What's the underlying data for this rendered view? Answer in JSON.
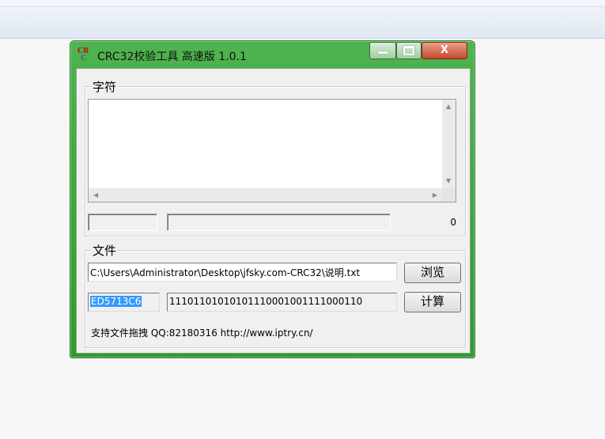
{
  "window": {
    "title": "CRC32校验工具 高速版 1.0.1",
    "icon_top": "CR",
    "icon_bottom": "C",
    "close_label": "X"
  },
  "groups": {
    "chars_label": "字符",
    "file_label": "文件"
  },
  "text_input": {
    "value": ""
  },
  "char_count": "0",
  "file": {
    "path": "C:\\Users\\Administrator\\Desktop\\jfsky.com-CRC32\\说明.txt",
    "browse_label": "浏览",
    "crc_hex": "ED5713C6",
    "crc_binary": "11101101010101110001001111000110",
    "calc_label": "计算"
  },
  "footer": "支持文件拖拽  QQ:82180316   http://www.iptry.cn/",
  "colors": {
    "window_frame": "#3aa43a",
    "selection": "#3399ff"
  }
}
